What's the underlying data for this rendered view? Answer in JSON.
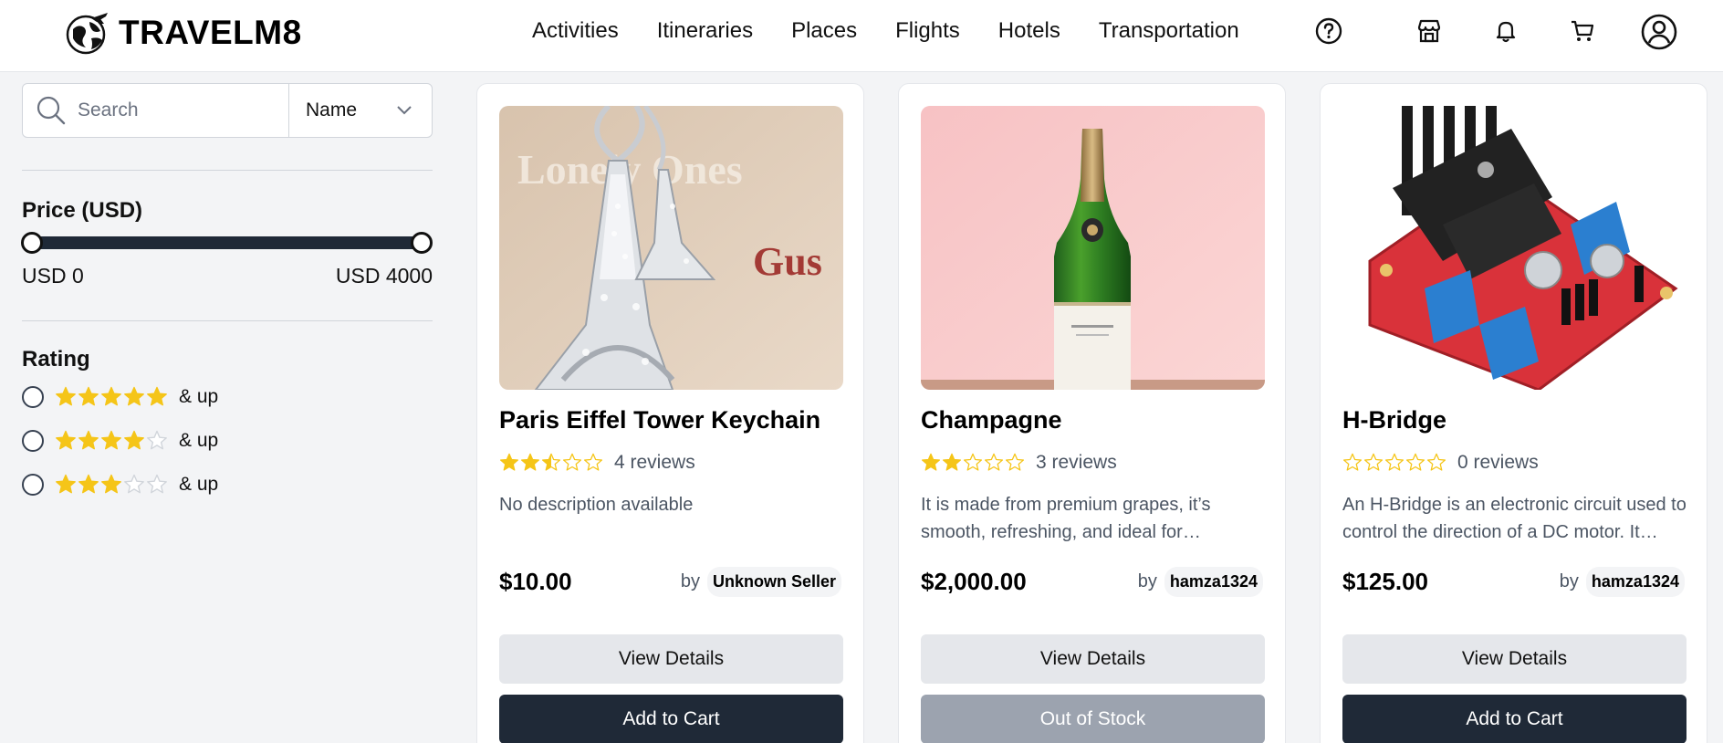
{
  "brand": {
    "name": "TRAVELM8",
    "logo_icon": "globe-plane-icon"
  },
  "nav": {
    "items": [
      {
        "label": "Activities"
      },
      {
        "label": "Itineraries"
      },
      {
        "label": "Places"
      },
      {
        "label": "Flights"
      },
      {
        "label": "Hotels"
      },
      {
        "label": "Transportation"
      }
    ]
  },
  "header_icons": [
    "help-icon",
    "store-icon",
    "bell-icon",
    "cart-icon",
    "user-icon"
  ],
  "filters": {
    "search": {
      "placeholder": "Search",
      "value": ""
    },
    "sort": {
      "selected": "Name"
    },
    "price": {
      "title": "Price (USD)",
      "min_label": "USD 0",
      "max_label": "USD 4000",
      "min": 0,
      "max": 4000
    },
    "rating": {
      "title": "Rating",
      "options": [
        {
          "stars": 5,
          "label": "& up"
        },
        {
          "stars": 4,
          "label": "& up"
        },
        {
          "stars": 3,
          "label": "& up"
        }
      ]
    }
  },
  "products": [
    {
      "title": "Paris Eiffel Tower Keychain",
      "rating": 2.5,
      "reviews": "4 reviews",
      "description": "No description available",
      "price": "$10.00",
      "by": "by",
      "seller": "Unknown Seller",
      "details_label": "View Details",
      "action_label": "Add to Cart",
      "in_stock": true
    },
    {
      "title": "Champagne",
      "rating": 2,
      "reviews": "3 reviews",
      "description": "It is made from premium grapes, it’s smooth, refreshing, and ideal for celebrations",
      "price": "$2,000.00",
      "by": "by",
      "seller": "hamza1324",
      "details_label": "View Details",
      "action_label": "Out of Stock",
      "in_stock": false
    },
    {
      "title": "H-Bridge",
      "rating": 0,
      "reviews": "0 reviews",
      "description": "An H-Bridge is an electronic circuit used to control the direction of a DC motor. It allows",
      "price": "$125.00",
      "by": "by",
      "seller": "hamza1324",
      "details_label": "View Details",
      "action_label": "Add to Cart",
      "in_stock": true
    }
  ],
  "colors": {
    "star": "#f5c518",
    "star_empty": "#d1d5db",
    "primary_button": "#1f2937",
    "disabled_button": "#9ca3af"
  }
}
